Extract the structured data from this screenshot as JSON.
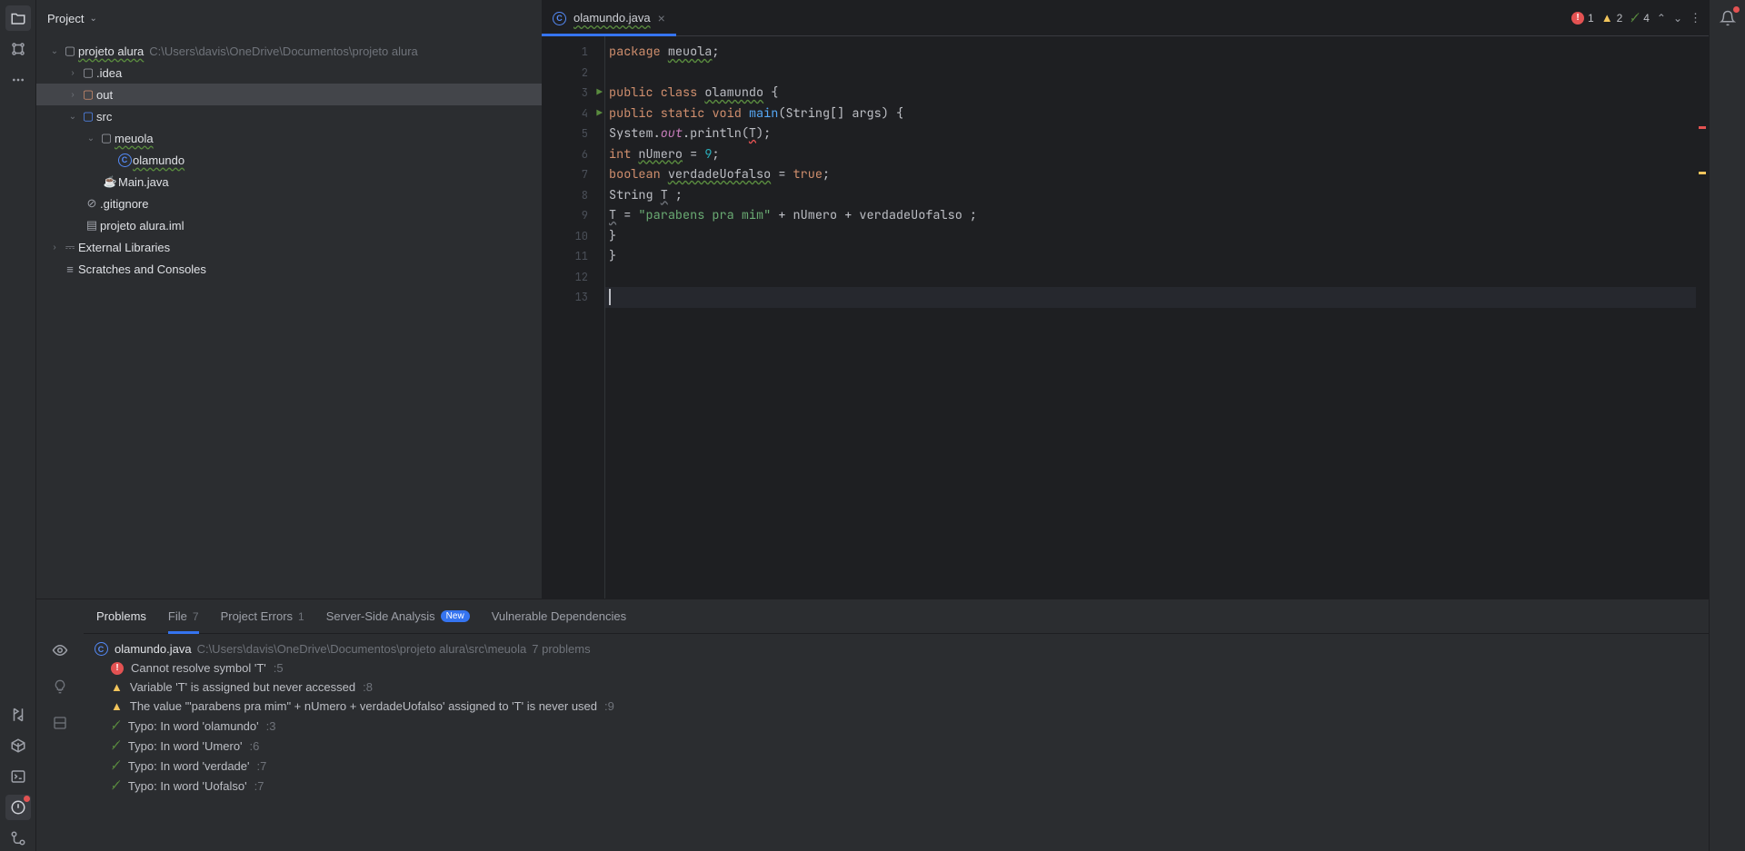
{
  "project": {
    "title": "Project",
    "root": {
      "name": "projeto alura",
      "path": "C:\\Users\\davis\\OneDrive\\Documentos\\projeto alura"
    },
    "tree": {
      "idea": ".idea",
      "out": "out",
      "src": "src",
      "meuola": "meuola",
      "olamundo": "olamundo",
      "main": "Main.java",
      "gitignore": ".gitignore",
      "iml": "projeto alura.iml",
      "extlib": "External Libraries",
      "scratches": "Scratches and Consoles"
    }
  },
  "editor": {
    "tab": {
      "filename": "olamundo.java"
    },
    "inspections": {
      "errors": "1",
      "warnings": "2",
      "typos": "4"
    },
    "lines": [
      "1",
      "2",
      "3",
      "4",
      "5",
      "6",
      "7",
      "8",
      "9",
      "10",
      "11",
      "12",
      "13"
    ]
  },
  "code": {
    "l1": {
      "kw": "package",
      "pkg": "meuola",
      "semi": ";"
    },
    "l3": {
      "kw1": "public",
      "kw2": "class",
      "cls": "olamundo",
      "brace": " {"
    },
    "l4": {
      "kw1": "public",
      "kw2": "static",
      "kw3": "void",
      "fn": "main",
      "args": "(String[] args) {"
    },
    "l5": {
      "pre": "System.",
      "out": "out",
      "mid": ".println(",
      "t": "T",
      "end": ");"
    },
    "l6": {
      "kw": "int",
      "var": "nUmero",
      "eq": " = ",
      "num": "9",
      "semi": ";"
    },
    "l7": {
      "kw": "boolean",
      "var": "verdadeUofalso",
      "eq": " = ",
      "val": "true",
      "semi": ";"
    },
    "l8": {
      "kw": "String",
      "var": "T",
      "semi": " ;"
    },
    "l9": {
      "t": "T",
      "eq": " = ",
      "str": "\"parabens pra mim\"",
      "rest": " + nUmero + verdadeUofalso ;"
    },
    "l10": "}",
    "l11": "}"
  },
  "problems": {
    "title": "Problems",
    "tabs": {
      "file": "File",
      "fileCount": "7",
      "projectErrors": "Project Errors",
      "projectErrorsCount": "1",
      "serverSide": "Server-Side Analysis",
      "serverSideBadge": "New",
      "vulnerable": "Vulnerable Dependencies"
    },
    "file": {
      "name": "olamundo.java",
      "path": "C:\\Users\\davis\\OneDrive\\Documentos\\projeto alura\\src\\meuola",
      "count": "7 problems"
    },
    "items": [
      {
        "type": "error",
        "msg": "Cannot resolve symbol 'T'",
        "loc": ":5"
      },
      {
        "type": "warn",
        "msg": "Variable 'T' is assigned but never accessed",
        "loc": ":8"
      },
      {
        "type": "warn",
        "msg": "The value '\"parabens pra mim\" + nUmero + verdadeUofalso' assigned to 'T' is never used",
        "loc": ":9"
      },
      {
        "type": "typo",
        "msg": "Typo: In word 'olamundo'",
        "loc": ":3"
      },
      {
        "type": "typo",
        "msg": "Typo: In word 'Umero'",
        "loc": ":6"
      },
      {
        "type": "typo",
        "msg": "Typo: In word 'verdade'",
        "loc": ":7"
      },
      {
        "type": "typo",
        "msg": "Typo: In word 'Uofalso'",
        "loc": ":7"
      }
    ]
  }
}
